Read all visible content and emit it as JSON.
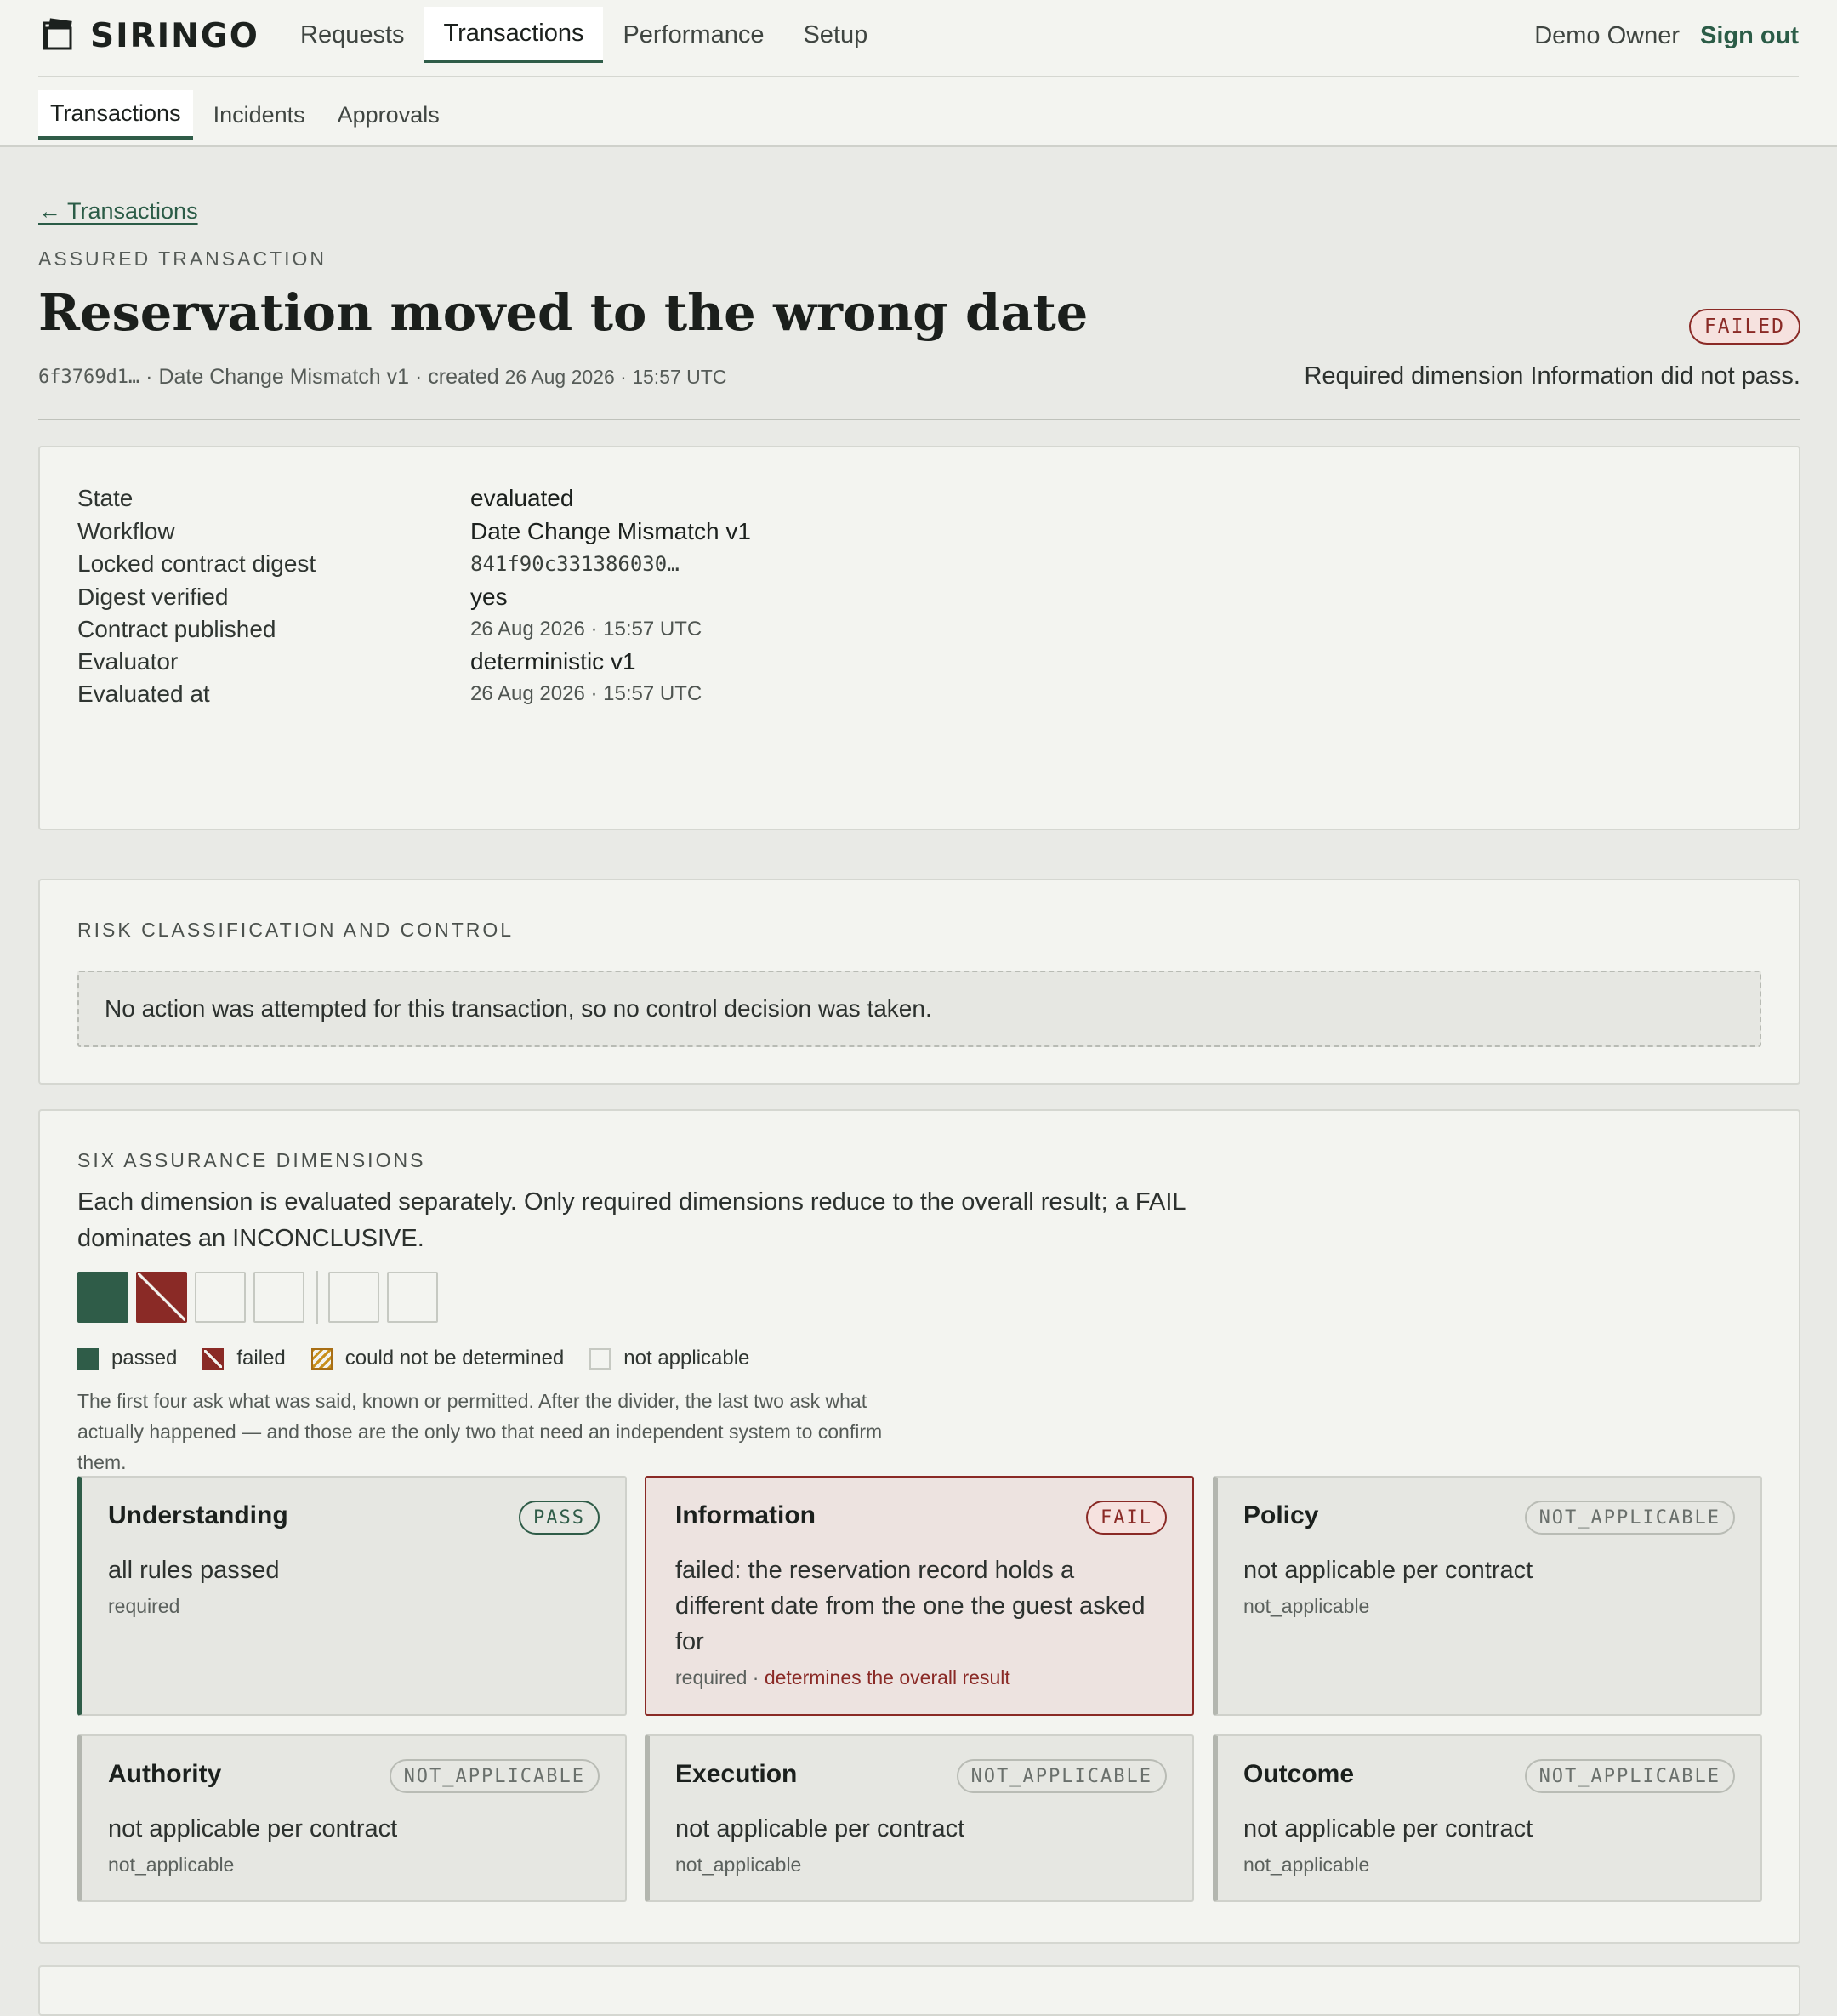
{
  "app": {
    "name": "SIRINGO",
    "logo_icon": "book-stack-icon"
  },
  "nav": {
    "tabs": [
      "Requests",
      "Transactions",
      "Performance",
      "Setup"
    ],
    "active": "Transactions"
  },
  "user": {
    "name": "Demo Owner",
    "sign_out": "Sign out"
  },
  "subnav": {
    "tabs": [
      "Transactions",
      "Incidents",
      "Approvals"
    ],
    "active": "Transactions"
  },
  "header": {
    "back_link": "← Transactions",
    "eyebrow": "ASSURED TRANSACTION",
    "title": "Reservation moved to the wrong date",
    "status": "FAILED",
    "id": "6f3769d1…",
    "workflow": "· Date Change Mismatch v1 · created",
    "created": "26 Aug 2026 · 15:57 UTC",
    "status_reason": "Required dimension Information did not pass."
  },
  "facts": [
    {
      "label": "State",
      "value": "evaluated",
      "kind": "text"
    },
    {
      "label": "Workflow",
      "value": "Date Change Mismatch v1",
      "kind": "text"
    },
    {
      "label": "Locked contract digest",
      "value": "841f90c331386030…",
      "kind": "mono"
    },
    {
      "label": "Digest verified",
      "value": "yes",
      "kind": "text"
    },
    {
      "label": "Contract published",
      "value": "26 Aug 2026 · 15:57 UTC",
      "kind": "date"
    },
    {
      "label": "Evaluator",
      "value": "deterministic v1",
      "kind": "text"
    },
    {
      "label": "Evaluated at",
      "value": "26 Aug 2026 · 15:57 UTC",
      "kind": "date"
    }
  ],
  "risk": {
    "heading": "RISK CLASSIFICATION AND CONTROL",
    "note": "No action was attempted for this transaction, so no control decision was taken."
  },
  "dimensions": {
    "heading": "SIX ASSURANCE DIMENSIONS",
    "description": "Each dimension is evaluated separately. Only required dimensions reduce to the overall result; a FAIL dominates an INCONCLUSIVE.",
    "strip": [
      "pass",
      "fail",
      "not_applicable",
      "not_applicable",
      "not_applicable",
      "not_applicable"
    ],
    "legend": {
      "passed": "passed",
      "failed": "failed",
      "inconclusive": "could not be determined",
      "not_applicable": "not applicable"
    },
    "note": "The first four ask what was said, known or permitted. After the divider, the last two ask what actually happened — and those are the only two that need an independent system to confirm them.",
    "cards": [
      {
        "name": "Understanding",
        "status": "PASS",
        "kind": "pass",
        "summary": "all rules passed",
        "meta": "required",
        "emphasis": ""
      },
      {
        "name": "Information",
        "status": "FAIL",
        "kind": "fail",
        "summary": "failed: the reservation record holds a different date from the one the guest asked for",
        "meta": "required ·",
        "emphasis": "determines the overall result"
      },
      {
        "name": "Policy",
        "status": "NOT_APPLICABLE",
        "kind": "na",
        "summary": "not applicable per contract",
        "meta": "not_applicable",
        "emphasis": ""
      },
      {
        "name": "Authority",
        "status": "NOT_APPLICABLE",
        "kind": "na",
        "summary": "not applicable per contract",
        "meta": "not_applicable",
        "emphasis": ""
      },
      {
        "name": "Execution",
        "status": "NOT_APPLICABLE",
        "kind": "na",
        "summary": "not applicable per contract",
        "meta": "not_applicable",
        "emphasis": ""
      },
      {
        "name": "Outcome",
        "status": "NOT_APPLICABLE",
        "kind": "na",
        "summary": "not applicable per contract",
        "meta": "not_applicable",
        "emphasis": ""
      }
    ]
  },
  "colors": {
    "pass": "#2f5c48",
    "fail": "#8a2a26",
    "inconclusive": "#c8901c",
    "background": "#e9eae6"
  }
}
